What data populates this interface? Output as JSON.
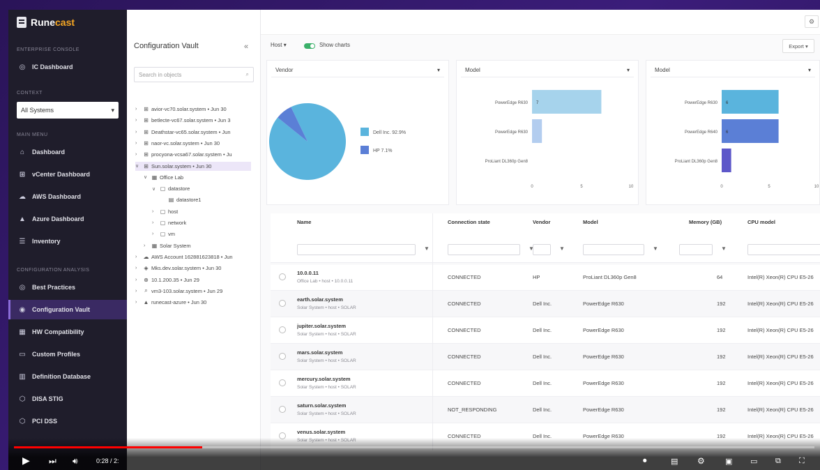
{
  "sidebar": {
    "logo": {
      "part1": "Rune",
      "part2": "cast"
    },
    "sections": {
      "enterprise": "ENTERPRISE CONSOLE",
      "context": "CONTEXT",
      "main_menu": "MAIN MENU",
      "config_analysis": "CONFIGURATION ANALYSIS"
    },
    "ic_dashboard": "IC Dashboard",
    "context_select": "All Systems",
    "items": [
      {
        "label": "Dashboard",
        "icon": "home-icon"
      },
      {
        "label": "vCenter Dashboard",
        "icon": "vcenter-icon"
      },
      {
        "label": "AWS Dashboard",
        "icon": "aws-icon"
      },
      {
        "label": "Azure Dashboard",
        "icon": "azure-icon"
      },
      {
        "label": "Inventory",
        "icon": "inventory-icon"
      }
    ],
    "analysis_items": [
      {
        "label": "Best Practices",
        "icon": "best-practices-icon"
      },
      {
        "label": "Configuration Vault",
        "icon": "vault-icon",
        "active": true
      },
      {
        "label": "HW Compatibility",
        "icon": "hw-icon"
      },
      {
        "label": "Custom Profiles",
        "icon": "profiles-icon"
      },
      {
        "label": "Definition Database",
        "icon": "database-icon"
      },
      {
        "label": "DISA STIG",
        "icon": "shield-icon"
      },
      {
        "label": "PCI DSS",
        "icon": "shield-icon"
      }
    ]
  },
  "tree": {
    "title": "Configuration Vault",
    "search_placeholder": "Search in objects",
    "rows": [
      {
        "label": "avior-vc70.solar.system • Jun 30",
        "depth": 0,
        "chev": ">",
        "icon": "vcenter-icon"
      },
      {
        "label": "betlecte-vc67.solar.system • Jun 3",
        "depth": 0,
        "chev": ">",
        "icon": "vcenter-icon"
      },
      {
        "label": "Deathstar-vc65.solar.system • Jun",
        "depth": 0,
        "chev": ">",
        "icon": "vcenter-icon"
      },
      {
        "label": "naor-vc.solar.system • Jun 30",
        "depth": 0,
        "chev": ">",
        "icon": "vcenter-icon"
      },
      {
        "label": "procyona-vcsa67.solar.system • Ju",
        "depth": 0,
        "chev": ">",
        "icon": "vcenter-icon"
      },
      {
        "label": "Sun.solar.system • Jun 30",
        "depth": 0,
        "chev": "v",
        "icon": "vcenter-icon",
        "selected": true
      },
      {
        "label": "Office Lab",
        "depth": 1,
        "chev": "v",
        "icon": "datacenter-icon"
      },
      {
        "label": "datastore",
        "depth": 2,
        "chev": "v",
        "icon": "folder-icon"
      },
      {
        "label": "datastore1",
        "depth": 3,
        "chev": "",
        "icon": "datastore-icon"
      },
      {
        "label": "host",
        "depth": 2,
        "chev": ">",
        "icon": "folder-icon"
      },
      {
        "label": "network",
        "depth": 2,
        "chev": ">",
        "icon": "folder-icon"
      },
      {
        "label": "vm",
        "depth": 2,
        "chev": ">",
        "icon": "folder-icon"
      },
      {
        "label": "Solar System",
        "depth": 1,
        "chev": ">",
        "icon": "datacenter-icon"
      },
      {
        "label": "AWS Account 1628816​23818 • Jun",
        "depth": 0,
        "chev": ">",
        "icon": "aws-icon"
      },
      {
        "label": "Mks.dev.solar.system • Jun 30",
        "depth": 0,
        "chev": ">",
        "icon": "vm-icon"
      },
      {
        "label": "10.1.200.35 • Jun 29",
        "depth": 0,
        "chev": ">",
        "icon": "globe-icon"
      },
      {
        "label": "vm3-103.solar.system • Jun 29",
        "depth": 0,
        "chev": ">",
        "icon": "search-icon"
      },
      {
        "label": "runecast-azure • Jun 30",
        "depth": 0,
        "chev": ">",
        "icon": "azure-icon"
      }
    ]
  },
  "toolbar": {
    "host_select": "Host",
    "show_charts": "Show charts",
    "export": "Export"
  },
  "charts": [
    {
      "select_label": "Vendor",
      "chart_data": {
        "type": "pie",
        "categories": [
          "Dell Inc.",
          "HP"
        ],
        "values": [
          92.9,
          7.1
        ],
        "legend_labels": [
          "Dell Inc.   92.9%",
          "HP   7.1%"
        ],
        "colors": [
          "#5ab4dd",
          "#5b7fd6"
        ]
      }
    },
    {
      "select_label": "Model",
      "chart_data": {
        "type": "bar",
        "categories": [
          "PowerEdge R630",
          "PowerEdge R630",
          "ProLiant DL360p Gen8"
        ],
        "values": [
          7,
          1,
          0
        ],
        "bar_labels": [
          "7",
          "",
          ""
        ],
        "colors": [
          "#a6d3ec",
          "#b3cdef",
          "#c9c3ea"
        ],
        "xticks": [
          "0",
          "5",
          "10"
        ],
        "xlim": [
          0,
          10
        ]
      }
    },
    {
      "select_label": "Model",
      "chart_data": {
        "type": "bar",
        "categories": [
          "PowerEdge R630",
          "PowerEdge R640",
          "ProLiant DL360p Gen8"
        ],
        "values": [
          6,
          6,
          1
        ],
        "bar_labels": [
          "6",
          "6",
          ""
        ],
        "colors": [
          "#5ab4dd",
          "#5b7fd6",
          "#5d57c9"
        ],
        "xticks": [
          "0",
          "5",
          "10"
        ],
        "xlim": [
          0,
          10
        ]
      }
    }
  ],
  "table": {
    "headers": [
      "Name",
      "Connection state",
      "Vendor",
      "Model",
      "Memory (GB)",
      "CPU model"
    ],
    "filter_icon": "filter-icon",
    "rows": [
      {
        "name": "10.0.0.11",
        "path": "Office Lab • host • 10.0.0.11",
        "state": "CONNECTED",
        "vendor": "HP",
        "model": "ProLiant DL360p Gen8",
        "memory": "64",
        "cpu": "Intel(R) Xeon(R) CPU E5-26"
      },
      {
        "name": "earth.solar.system",
        "path": "Solar System • host • SOLAR",
        "state": "CONNECTED",
        "vendor": "Dell Inc.",
        "model": "PowerEdge R630",
        "memory": "192",
        "cpu": "Intel(R) Xeon(R) CPU E5-26"
      },
      {
        "name": "jupiter.solar.system",
        "path": "Solar System • host • SOLAR",
        "state": "CONNECTED",
        "vendor": "Dell Inc.",
        "model": "PowerEdge R630",
        "memory": "192",
        "cpu": "Intel(R) Xeon(R) CPU E5-26"
      },
      {
        "name": "mars.solar.system",
        "path": "Solar System • host • SOLAR",
        "state": "CONNECTED",
        "vendor": "Dell Inc.",
        "model": "PowerEdge R630",
        "memory": "192",
        "cpu": "Intel(R) Xeon(R) CPU E5-26"
      },
      {
        "name": "mercury.solar.system",
        "path": "Solar System • host • SOLAR",
        "state": "CONNECTED",
        "vendor": "Dell Inc.",
        "model": "PowerEdge R630",
        "memory": "192",
        "cpu": "Intel(R) Xeon(R) CPU E5-26"
      },
      {
        "name": "saturn.solar.system",
        "path": "Solar System • host • SOLAR",
        "state": "NOT_RESPONDING",
        "vendor": "Dell Inc.",
        "model": "PowerEdge R630",
        "memory": "192",
        "cpu": "Intel(R) Xeon(R) CPU E5-26"
      },
      {
        "name": "venus.solar.system",
        "path": "Solar System • host • SOLAR",
        "state": "CONNECTED",
        "vendor": "Dell Inc.",
        "model": "PowerEdge R630",
        "memory": "192",
        "cpu": "Intel(R) Xeon(R) CPU E5-26"
      }
    ]
  },
  "video": {
    "time": "0:28 / 2:",
    "progress": 0.235,
    "icons": [
      "play-icon",
      "next-icon",
      "volume-icon",
      "autoplay-icon",
      "subtitles-icon",
      "settings-icon",
      "miniplayer-icon",
      "theater-icon",
      "cast-icon",
      "fullscreen-icon"
    ]
  }
}
